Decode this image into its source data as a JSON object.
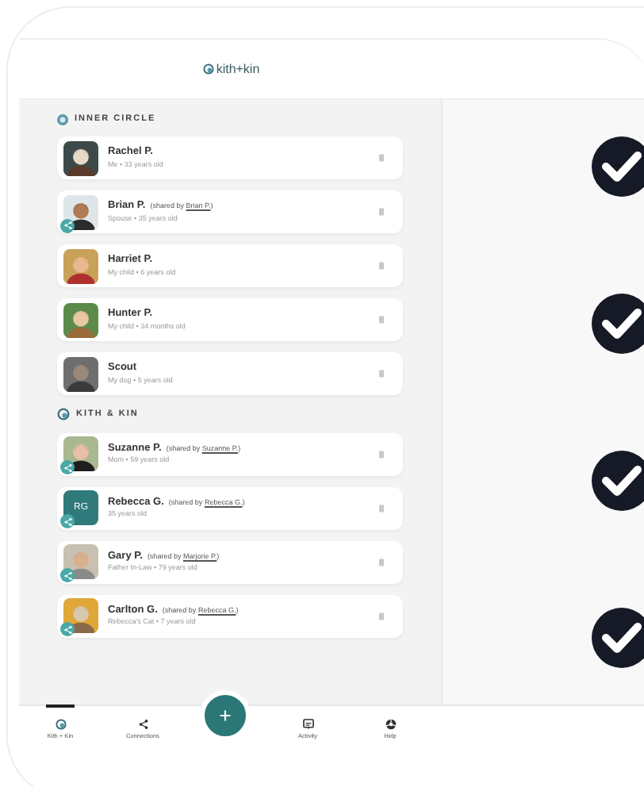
{
  "app": {
    "logo": "kith+kin"
  },
  "sections": [
    {
      "title": "INNER CIRCLE",
      "kind": "circle",
      "people": [
        {
          "name": "Rachel P.",
          "details": "Me • 33 years old"
        },
        {
          "name": "Brian P.",
          "shared": {
            "prefix": "(shared by",
            "name": "Brian P.",
            "suffix": ")"
          },
          "details": "Spouse • 35 years old"
        },
        {
          "name": "Harriet P.",
          "details": "My child • 6 years old"
        },
        {
          "name": "Hunter P.",
          "details": "My child • 34 months old"
        },
        {
          "name": "Scout",
          "details": "My dog • 5 years old"
        }
      ]
    },
    {
      "title": "KITH & KIN",
      "kind": "kin",
      "people": [
        {
          "name": "Suzanne P.",
          "shared": {
            "prefix": "(shared by",
            "name": "Suzanne P.",
            "suffix": ")"
          },
          "details": "Mom • 59 years old"
        },
        {
          "name": "Rebecca G.",
          "shared": {
            "prefix": "(shared by",
            "name": "Rebecca G.",
            "suffix": ")"
          },
          "details": "35 years old",
          "avatar": {
            "kind": "initials",
            "initials": "RG"
          }
        },
        {
          "name": "Gary P.",
          "shared": {
            "prefix": "(shared by",
            "name": "Marjorie P.",
            "suffix": ")"
          },
          "details": "Father In-Law • 79 years old"
        },
        {
          "name": "Carlton G.",
          "shared": {
            "prefix": "(shared by",
            "name": "Rebecca G.",
            "suffix": ")"
          },
          "details": "Rebecca's Cat • 7 years old"
        }
      ]
    }
  ],
  "nav": [
    {
      "label": "Kith + Kin",
      "kind": "home",
      "selected": true
    },
    {
      "label": "Connections",
      "kind": "share",
      "selected": false
    },
    {
      "kind": "add",
      "selected": false
    },
    {
      "label": "Activity",
      "kind": "activity",
      "selected": false
    },
    {
      "label": "Help",
      "kind": "help",
      "selected": false
    }
  ]
}
